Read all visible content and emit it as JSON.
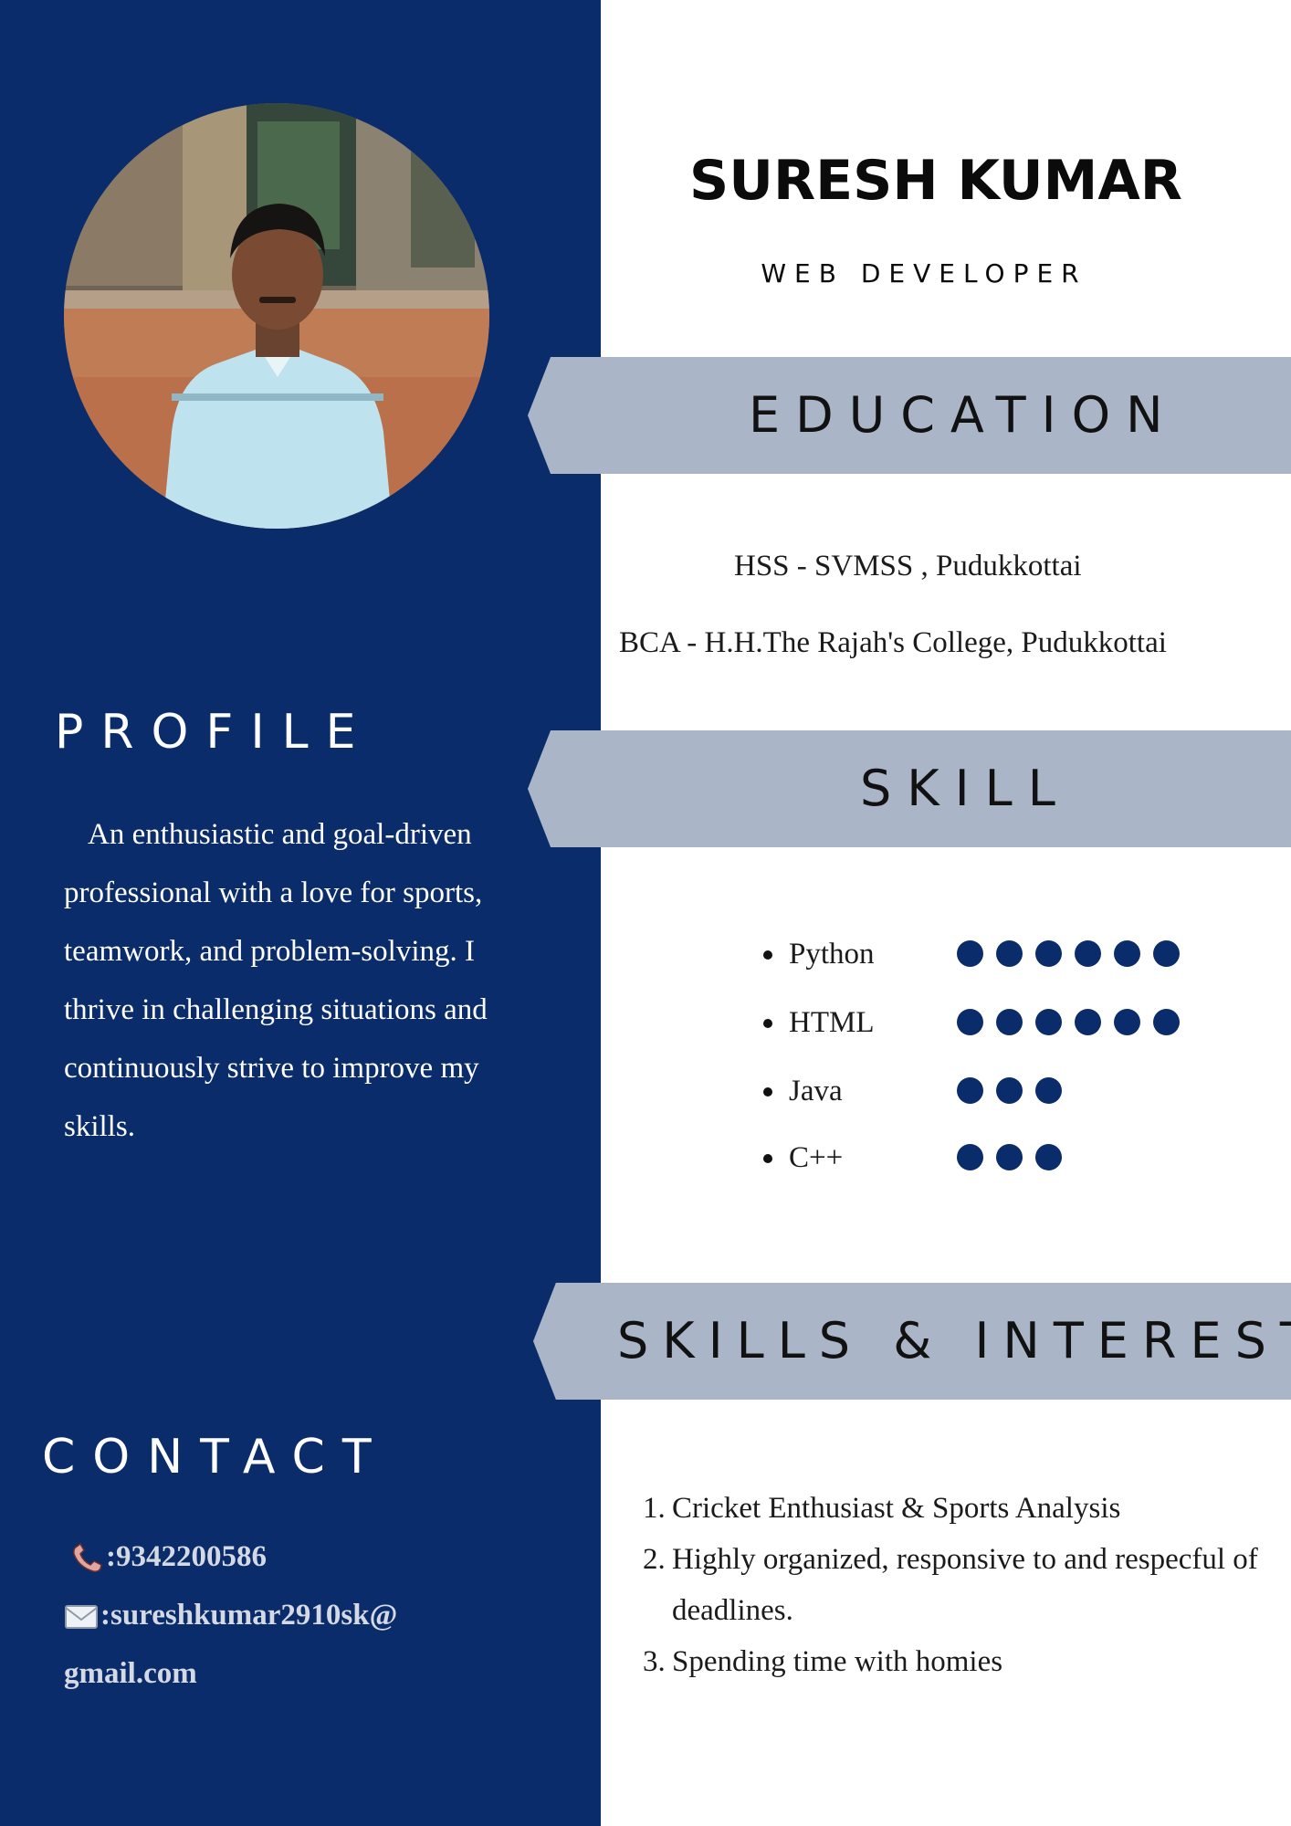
{
  "profile_card": {
    "name": "SURESH KUMAR",
    "role": "WEB DEVELOPER"
  },
  "sidebar": {
    "profile_heading": "PROFILE",
    "profile_text": "An enthusiastic and goal-driven professional with a love for sports, teamwork, and problem-solving. I thrive in challenging situations and continuously strive to improve my skills.",
    "contact_heading": "CONTACT",
    "phone": ":9342200586",
    "email_line1": ":sureshkumar2910sk@",
    "email_line2": "gmail.com",
    "phone_icon": "phone-icon",
    "email_icon": "email-icon",
    "photo": "profile-photo"
  },
  "education": {
    "heading": "EDUCATION",
    "entries": [
      "HSS - SVMSS , Pudukkottai",
      "BCA - H.H.The Rajah's College, Pudukkottai"
    ]
  },
  "skills": {
    "heading": "SKILL",
    "items": [
      {
        "name": "Python",
        "level": 6
      },
      {
        "name": "HTML",
        "level": 6
      },
      {
        "name": "Java",
        "level": 3
      },
      {
        "name": "C++",
        "level": 3
      }
    ]
  },
  "interests": {
    "heading": "SKILLS & INTEREST",
    "items": [
      {
        "num": "1.",
        "text": "Cricket Enthusiast & Sports Analysis"
      },
      {
        "num": "2.",
        "text": "Highly organized, responsive to and respecful of deadlines."
      },
      {
        "num": "3.",
        "text": "Spending time with homies"
      }
    ]
  },
  "colors": {
    "sidebar": "#0a2c6b",
    "banner": "#aab6c8",
    "skill_dot": "#0a2c6b"
  }
}
